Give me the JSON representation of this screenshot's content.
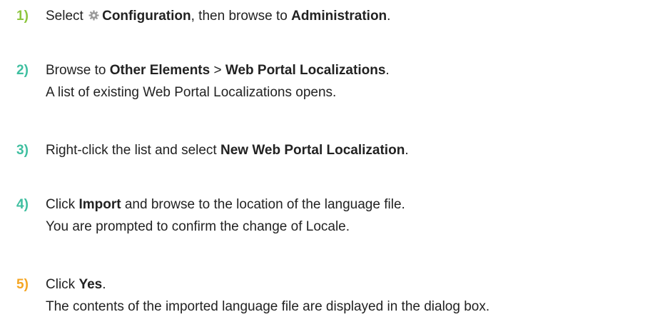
{
  "steps": [
    {
      "number": "1)",
      "segments": {
        "t1": "Select",
        "b1": "Configuration",
        "t2": ", then browse to",
        "b2": "Administration",
        "t3": "."
      },
      "icon": "gear-icon"
    },
    {
      "number": "2)",
      "segments": {
        "t1": "Browse to",
        "b1": "Other Elements",
        "t2": " > ",
        "b2": "Web Portal Localizations",
        "t3": "."
      },
      "result": "A list of existing Web Portal Localizations opens."
    },
    {
      "number": "3)",
      "segments": {
        "t1": "Right-click the list and select",
        "b1": "New Web Portal Localization",
        "t2": "."
      }
    },
    {
      "number": "4)",
      "segments": {
        "t1": "Click",
        "b1": "Import",
        "t2": " and browse to the location of the language file."
      },
      "result": "You are prompted to confirm the change of Locale."
    },
    {
      "number": "5)",
      "segments": {
        "t1": "Click",
        "b1": "Yes",
        "t2": "."
      },
      "result": "The contents of the imported language file are displayed in the dialog box."
    }
  ],
  "colors": {
    "step_1": "#8dc63f",
    "step_2": "#3fbfa0",
    "step_3": "#3fbfa0",
    "step_4": "#3fbfa0",
    "step_5": "#f5a623",
    "text": "#222222",
    "icon": "#999999"
  }
}
